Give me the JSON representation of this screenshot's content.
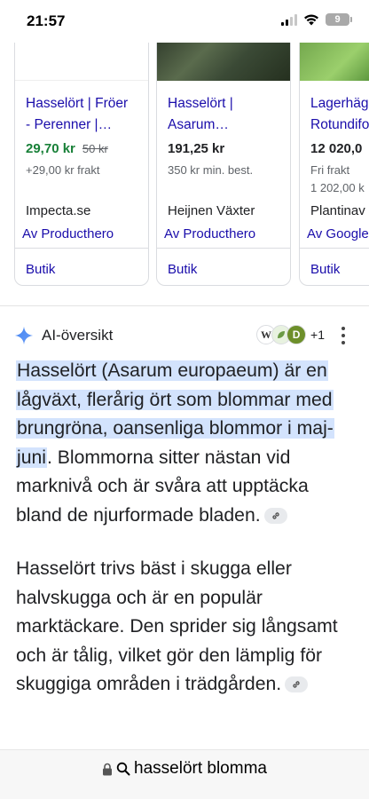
{
  "status_bar": {
    "time": "21:57",
    "battery": "9"
  },
  "products": [
    {
      "title": "Hasselört | Fröer\n- Perenner |…",
      "price": "29,70 kr",
      "old_price": "50 kr",
      "shipping": "+29,00 kr frakt",
      "shipping_extra": "",
      "seller": "Impecta.se",
      "source": "Av Producthero",
      "action": "Butik"
    },
    {
      "title": "Hasselört |\nAsarum…",
      "price": "191,25 kr",
      "old_price": "",
      "shipping": "350 kr min. best.",
      "shipping_extra": "",
      "seller": "Heijnen Växter",
      "source": "Av Producthero",
      "action": "Butik"
    },
    {
      "title": "Lagerhäg\nRotundifo",
      "price": "12 020,0",
      "old_price": "",
      "shipping": "Fri frakt",
      "shipping_extra": "1 202,00 k",
      "seller": "Plantinav",
      "source": "Av Google",
      "action": "Butik"
    }
  ],
  "ai_overview": {
    "title": "AI-översikt",
    "sources": [
      "W",
      "D"
    ],
    "sources_more": "+1",
    "highlighted_text": "Hasselört (Asarum europaeum) är en lågväxt, flerårig ört som blommar med brungröna, oansenliga blommor i maj-juni",
    "paragraph1_rest": ". Blommorna sitter nästan vid marknivå och är svåra att upptäcka bland de njurformade bladen.",
    "paragraph2": "Hasselört trivs bäst i skugga eller halvskugga och är en populär marktäckare. Den sprider sig långsamt och är tålig, vilket gör den lämplig för skuggiga områden i trädgården."
  },
  "address_bar": {
    "query": "hasselört blomma"
  },
  "colors": {
    "link_blue": "#1a0dab",
    "sale_green": "#188038",
    "highlight": "#d3e3fd",
    "sparkle_blue": "#4285f4"
  }
}
